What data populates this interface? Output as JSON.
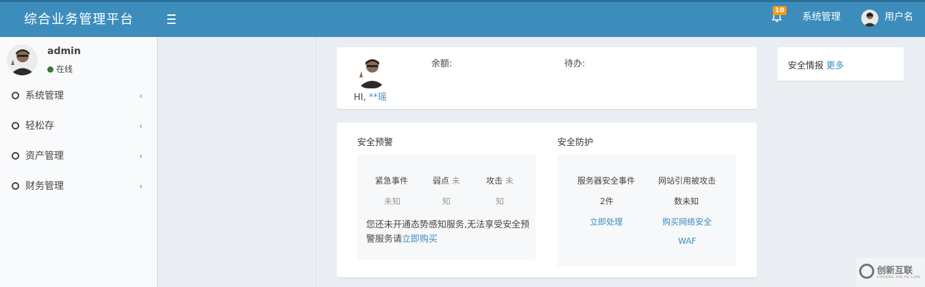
{
  "header": {
    "brand": "综合业务管理平台",
    "notification_count": "10",
    "system_link": "系统管理",
    "username": "用户名"
  },
  "sidebar": {
    "user": {
      "name": "admin",
      "status": "在线"
    },
    "items": [
      {
        "label": "系统管理"
      },
      {
        "label": "轻松存"
      },
      {
        "label": "资产管理"
      },
      {
        "label": "财务管理"
      }
    ]
  },
  "profile_card": {
    "greeting_prefix": "HI,",
    "greeting_name": "**瑶",
    "balance_label": "余额:",
    "todo_label": "待办:"
  },
  "security_warning": {
    "title": "安全预警",
    "cols": [
      {
        "label": "紧急事件",
        "label_suffix": "",
        "value": "未知"
      },
      {
        "label": "弱点",
        "label_suffix": "未",
        "value": "知"
      },
      {
        "label": "攻击",
        "label_suffix": "未",
        "value": "知"
      }
    ],
    "notice_text": "您还未开通态势感知服务,无法享受安全预警服务请",
    "notice_link": "立即购买"
  },
  "security_protection": {
    "title": "安全防护",
    "server_events_label": "服务器安全事件",
    "server_events_value": "2件",
    "server_events_action": "立即处理",
    "site_attack_label": "网站引用被攻击",
    "site_attack_value": "数未知",
    "site_attack_action_line1": "购买网络安全",
    "site_attack_action_line2": "WAF"
  },
  "intel": {
    "title": "安全情报",
    "more": "更多"
  },
  "watermark": {
    "text": "创新互联",
    "sub": "CHUANG XIN HU LIAN"
  },
  "colors": {
    "header_bg": "#3c8dbc",
    "link": "#3c8dbc",
    "badge": "#f39c12",
    "online": "#3c763d"
  }
}
